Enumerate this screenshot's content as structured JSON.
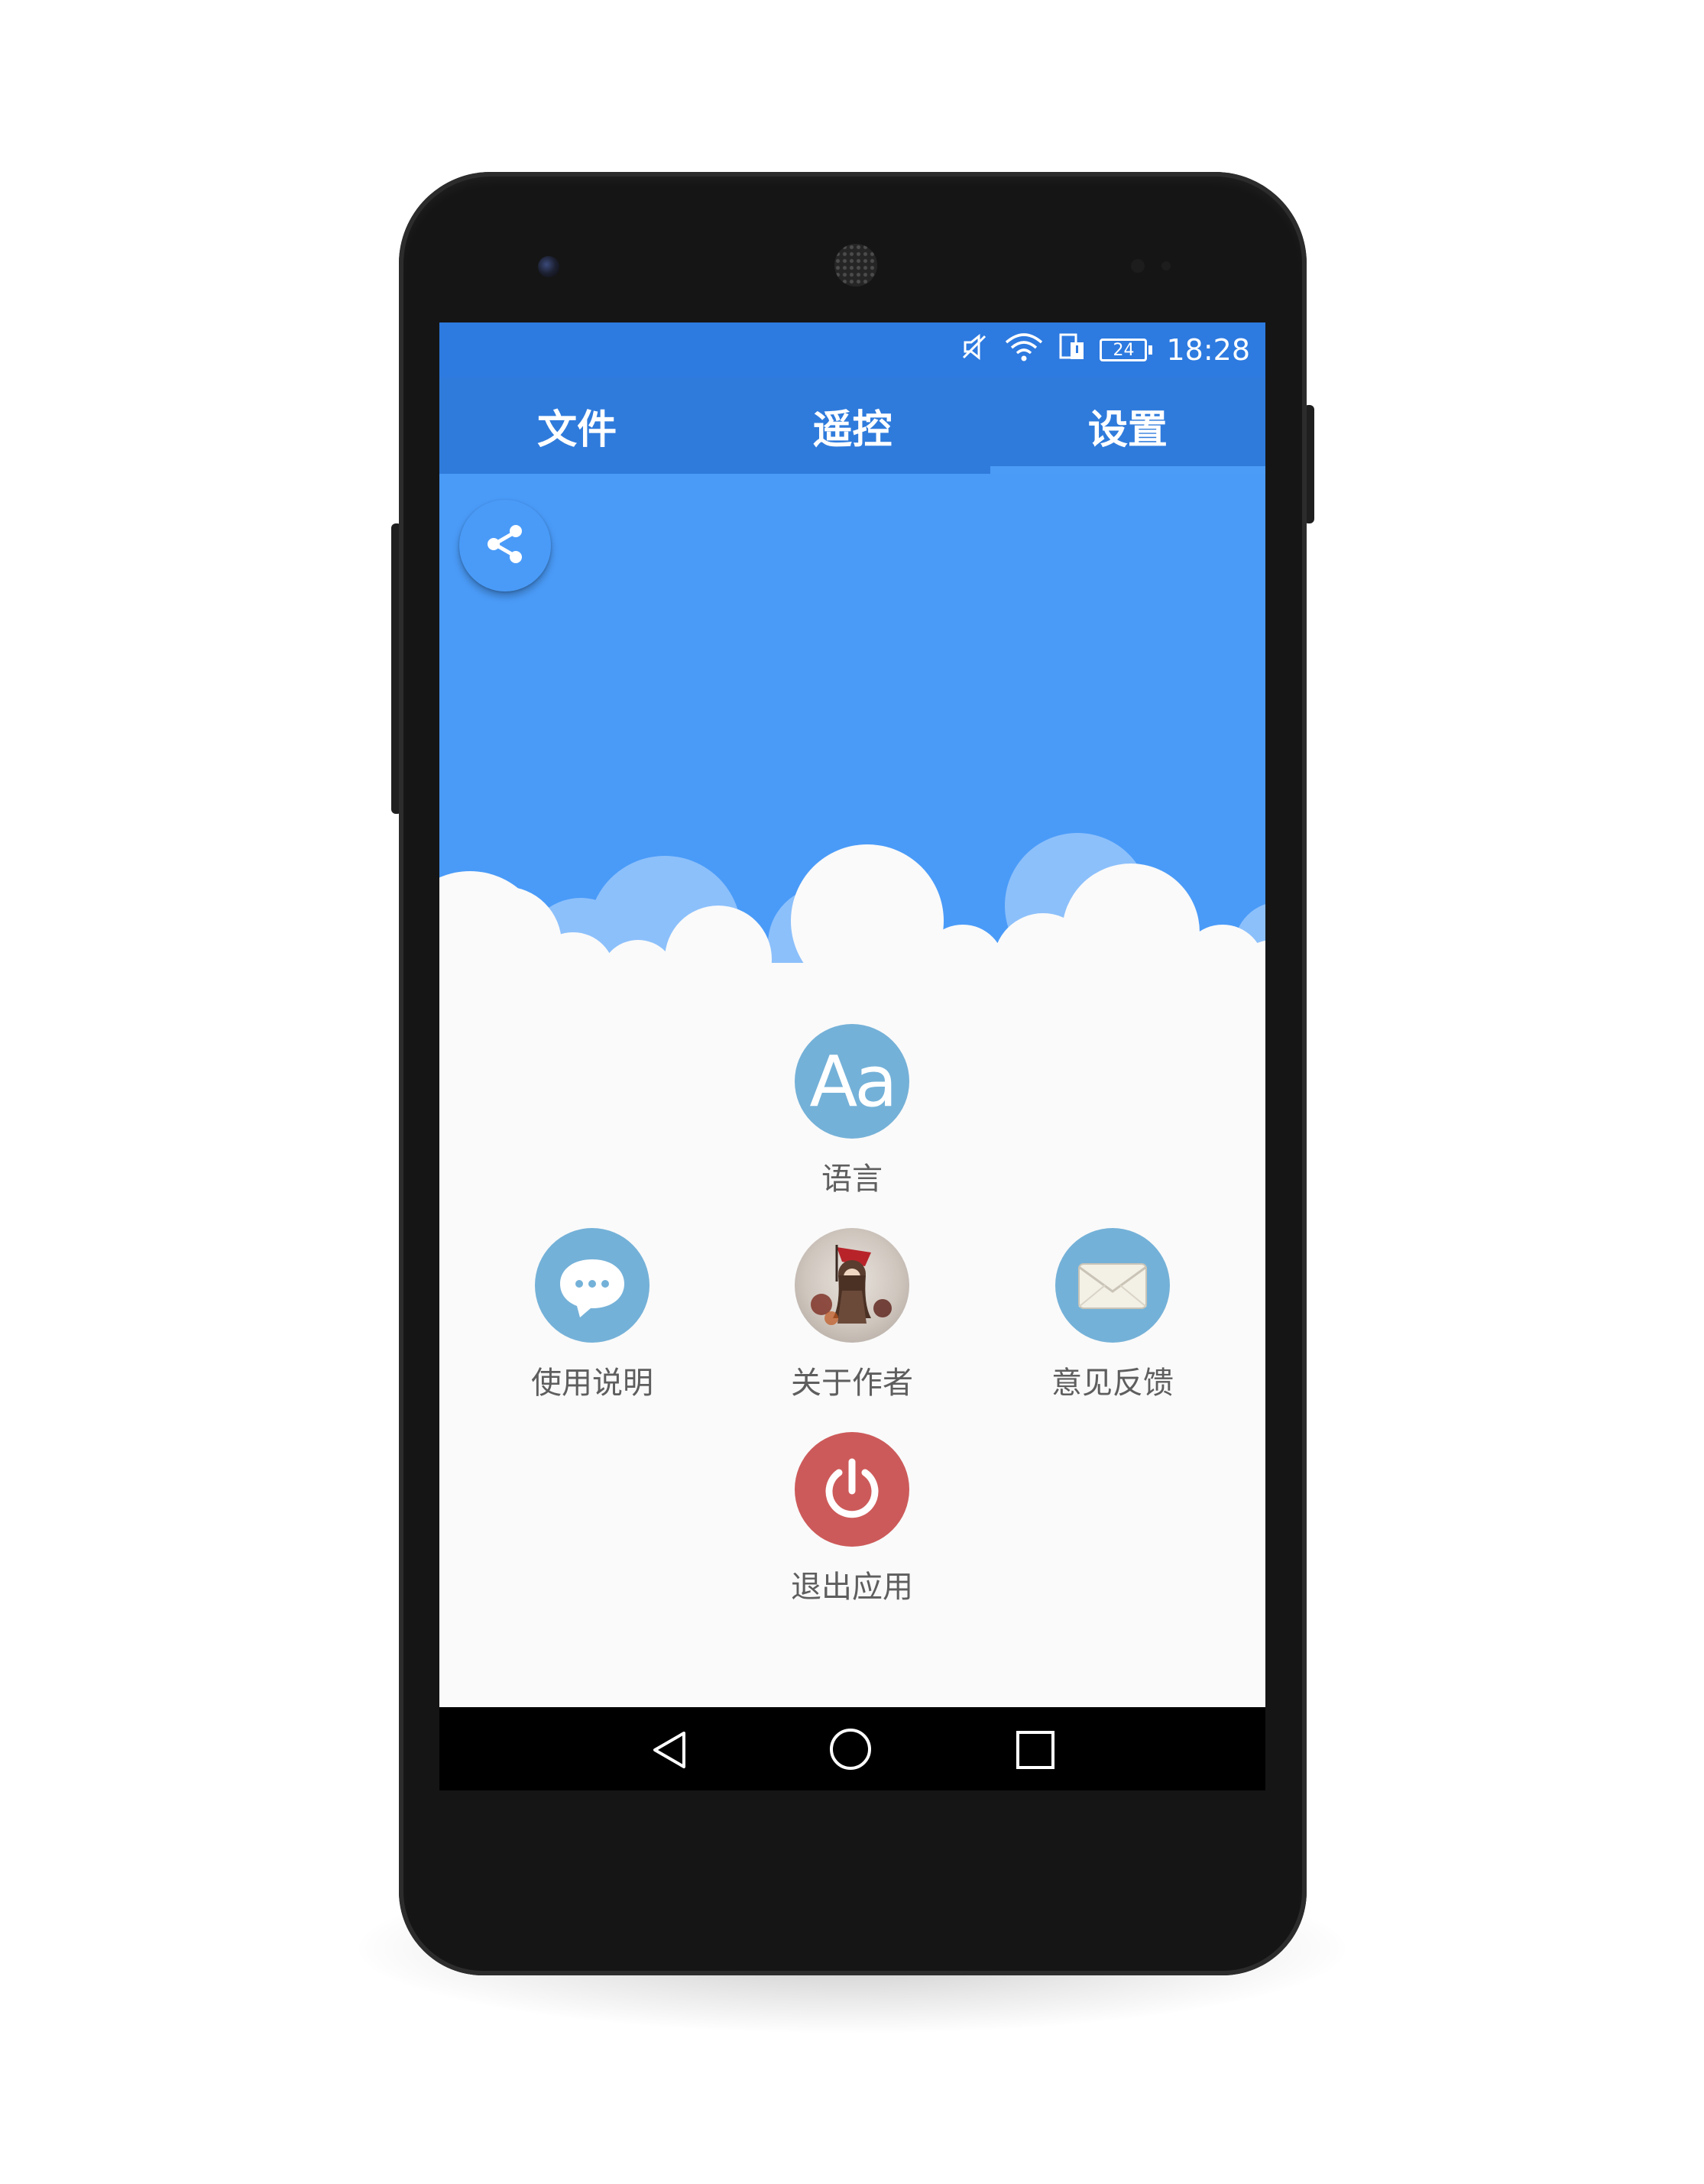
{
  "status_bar": {
    "battery": "24",
    "time": "18:28",
    "icons": [
      "mute-icon",
      "wifi-icon",
      "sim-icon",
      "battery-icon"
    ]
  },
  "tabs": [
    {
      "label": "文件"
    },
    {
      "label": "遥控"
    },
    {
      "label": "设置"
    }
  ],
  "selected_tab": "设置",
  "share_button": {
    "icon": "share-icon"
  },
  "menu": {
    "language": {
      "label": "语言",
      "icon_text": "Aa",
      "color": "#74b1d8"
    },
    "instructions": {
      "label": "使用说明",
      "color": "#74b1d8"
    },
    "about_author": {
      "label": "关于作者"
    },
    "feedback": {
      "label": "意见反馈",
      "color": "#74b1d8"
    },
    "exit": {
      "label": "退出应用",
      "color": "#cd5a5a"
    }
  },
  "colors": {
    "status_bar": "#2d7ae0",
    "tab_bar": "#2f7bdc",
    "hero": "#4a9bf8",
    "background": "#fafafa"
  }
}
